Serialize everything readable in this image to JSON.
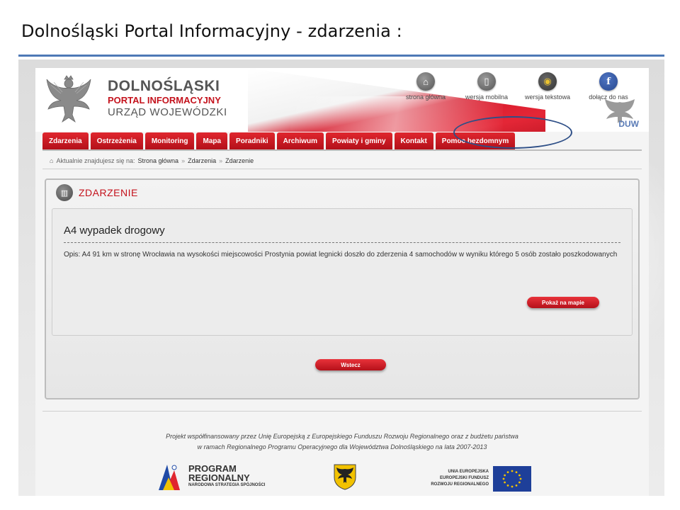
{
  "slide": {
    "title": "Dolnośląski Portal Informacyjny  - zdarzenia :"
  },
  "header": {
    "brand_line1": "DOLNOŚLĄSKI",
    "brand_line2": "PORTAL INFORMACYJNY",
    "brand_line3": "URZĄD WOJEWÓDZKI",
    "duw_label": "DUW",
    "top_links": [
      {
        "label": "strona główna",
        "icon": "home-icon"
      },
      {
        "label": "wersja mobilna",
        "icon": "mobile-icon"
      },
      {
        "label": "wersja tekstowa",
        "icon": "eye-icon"
      },
      {
        "label": "dołącz do nas",
        "icon": "facebook-icon"
      }
    ]
  },
  "nav": {
    "items": [
      "Zdarzenia",
      "Ostrzeżenia",
      "Monitoring",
      "Mapa",
      "Poradniki",
      "Archiwum",
      "Powiaty i gminy",
      "Kontakt",
      "Pomoc bezdomnym"
    ]
  },
  "breadcrumb": {
    "prefix": "Aktualnie znajdujesz się na:",
    "items": [
      "Strona główna",
      "Zdarzenia",
      "Zdarzenie"
    ],
    "separator": "»"
  },
  "event": {
    "section_title": "ZDARZENIE",
    "title": "A4 wypadek drogowy",
    "description": "Opis: A4 91 km w stronę Wrocławia na wysokości miejscowości Prostynia powiat legnicki doszło do zderzenia 4 samochodów w wyniku którego 5 osób zostało poszkodowanych",
    "map_button": "Pokaż na mapie",
    "back_button": "Wstecz"
  },
  "footer": {
    "line1": "Projekt współfinansowany przez Unię Europejską z Europejskiego Funduszu Rozwoju Regionalnego oraz z budżetu państwa",
    "line2": "w ramach Regionalnego Programu Operacyjnego dla Województwa Dolnośląskiego na lata 2007-2013",
    "program_line1": "PROGRAM",
    "program_line2": "REGIONALNY",
    "program_line3": "NARODOWA STRATEGIA SPÓJNOŚCI",
    "eu_line1": "UNIA EUROPEJSKA",
    "eu_line2": "EUROPEJSKI FUNDUSZ",
    "eu_line3": "ROZWOJU REGIONALNEGO"
  },
  "colors": {
    "accent_red": "#c4121c",
    "rule_blue": "#4e79b6",
    "highlight_blue": "#2e4f87"
  }
}
